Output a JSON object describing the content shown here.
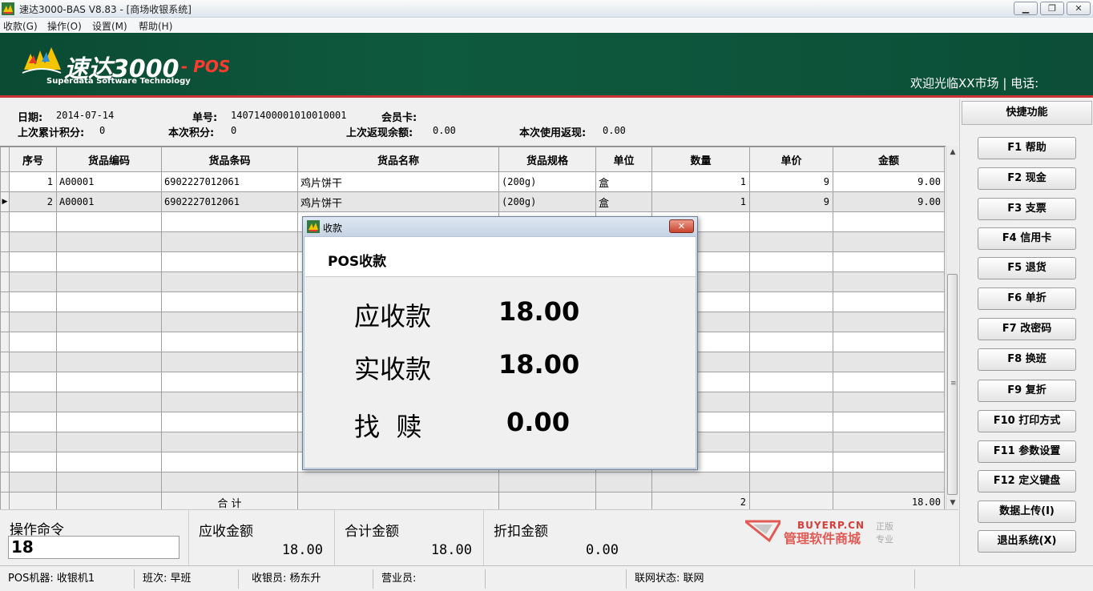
{
  "window": {
    "title": "速达3000-BAS V8.83 - [商场收银系统]"
  },
  "menu": [
    "收款(G)",
    "操作(O)",
    "设置(M)",
    "帮助(H)"
  ],
  "banner": {
    "logo_main": "速达3000",
    "logo_pos": "- POS",
    "logo_sub": "Superdata Software Technology",
    "welcome": "欢迎光临XX市场 | 电话:"
  },
  "info": {
    "date_label": "日期:",
    "date_value": "2014-07-14",
    "order_label": "单号:",
    "order_value": "14071400001010010001",
    "member_label": "会员卡:",
    "member_value": "",
    "prev_points_label": "上次累计积分:",
    "prev_points_value": "0",
    "cur_points_label": "本次积分:",
    "cur_points_value": "0",
    "prev_cashback_label": "上次返现余额:",
    "prev_cashback_value": "0.00",
    "cur_cashback_label": "本次使用返现:",
    "cur_cashback_value": "0.00"
  },
  "grid": {
    "columns": [
      "序号",
      "货品编码",
      "货品条码",
      "货品名称",
      "货品规格",
      "单位",
      "数量",
      "单价",
      "金额"
    ],
    "rows": [
      {
        "no": "1",
        "code": "A00001",
        "barcode": "6902227012061",
        "name": "鸡片饼干",
        "spec": "(200g)",
        "unit": "盒",
        "qty": "1",
        "price": "9",
        "amount": "9.00"
      },
      {
        "no": "2",
        "code": "A00001",
        "barcode": "6902227012061",
        "name": "鸡片饼干",
        "spec": "(200g)",
        "unit": "盒",
        "qty": "1",
        "price": "9",
        "amount": "9.00"
      }
    ],
    "total_label": "合 计",
    "total_qty": "2",
    "total_amount": "18.00"
  },
  "right_panel": {
    "title": "快捷功能",
    "buttons": [
      "F1 帮助",
      "F2 现金",
      "F3 支票",
      "F4 信用卡",
      "F5 退货",
      "F6 单折",
      "F7 改密码",
      "F8 换班",
      "F9 复折",
      "F10 打印方式",
      "F11 参数设置",
      "F12 定义键盘",
      "数据上传(I)",
      "退出系统(X)"
    ]
  },
  "bottom": {
    "cmd_label": "操作命令",
    "cmd_value": "18",
    "receivable_label": "应收金额",
    "receivable_value": "18.00",
    "total_label": "合计金额",
    "total_value": "18.00",
    "discount_label": "折扣金额",
    "discount_value": "0.00",
    "watermark_en": "BUYERP.CN",
    "watermark_cn": "管理软件商城",
    "watermark_side1": "正版",
    "watermark_side2": "专业"
  },
  "status": {
    "machine": "POS机器:  收银机1",
    "shift": "班次:  早班",
    "cashier": "收银员:  杨东升",
    "clerk": "营业员:",
    "network": "联网状态:  联网"
  },
  "dialog": {
    "title": "收款",
    "header": "POS收款",
    "receivable_label": "应收款",
    "receivable_value": "18.00",
    "received_label": "实收款",
    "received_value": "18.00",
    "change_label": "找  赎",
    "change_value": "0.00"
  },
  "colors": {
    "banner_green": "#0e5a3f",
    "banner_red_line": "#cc3333",
    "logo_pos_red": "#ff3b30",
    "dialog_close_red": "#c9432c"
  }
}
